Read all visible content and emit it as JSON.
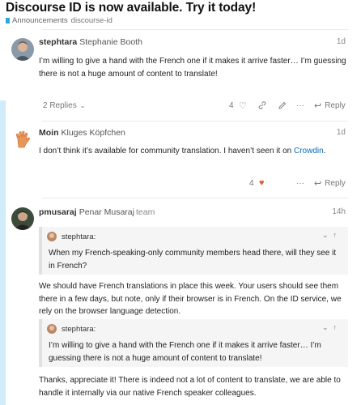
{
  "topic": {
    "title": "Discourse ID is now available. Try it today!",
    "category": "Announcements",
    "tag": "discourse-id",
    "category_color": "#25aae2"
  },
  "posts": [
    {
      "username": "stephtara",
      "full_name": "Stephanie Booth",
      "date": "1d",
      "body": "I’m willing to give a hand with the French one if it makes it arrive faster… I’m guessing there is not a huge amount of content to translate!",
      "replies_label": "2 Replies",
      "like_count": "4",
      "reply_label": "Reply"
    },
    {
      "username": "Moin",
      "full_name": "Kluges Köpfchen",
      "date": "1d",
      "body_before_link": "I don’t think it’s available for community translation. I haven’t seen it on ",
      "link_text": "Crowdin",
      "body_after_link": ".",
      "like_count": "4",
      "reply_label": "Reply",
      "liked_color": "#e45735"
    },
    {
      "username": "pmusaraj",
      "full_name": "Penar Musaraj",
      "badge": "team",
      "date": "14h",
      "quote1": {
        "author": "stephtara:",
        "text": "When my French-speaking-only community members head there, will they see it in French?"
      },
      "paragraph1": "We should have French translations in place this week. Your users should see them there in a few days, but note, only if their browser is in French. On the ID service, we rely on the browser language detection.",
      "quote2": {
        "author": "stephtara:",
        "text": "I’m willing to give a hand with the French one if it makes it arrive faster… I’m guessing there is not a huge amount of content to translate!"
      },
      "paragraph2": "Thanks, appreciate it! There is indeed not a lot of content to translate, we are able to handle it internally via our native French speaker colleagues."
    }
  ]
}
